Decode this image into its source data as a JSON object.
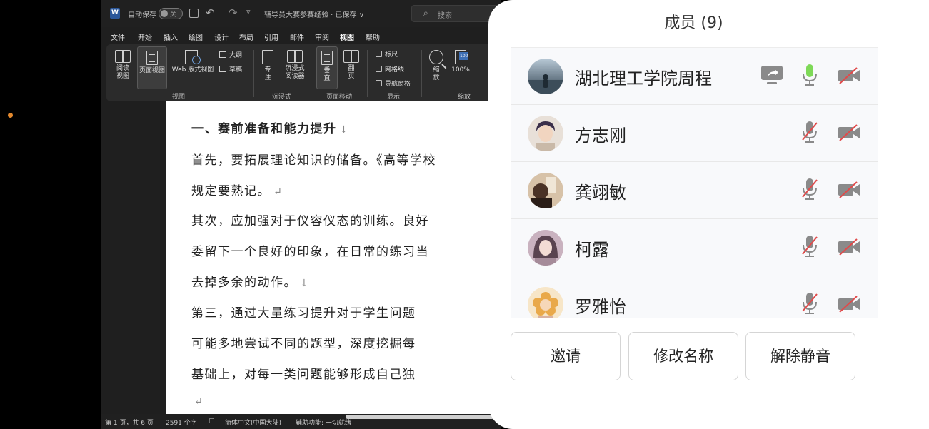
{
  "word": {
    "titlebar": {
      "logo_letter": "W",
      "autosave_label": "自动保存",
      "autosave_state": "关",
      "doc_title": "辅导员大赛参赛经验 · 已保存 ∨",
      "search_placeholder": "搜索"
    },
    "menu": [
      "文件",
      "开始",
      "插入",
      "绘图",
      "设计",
      "布局",
      "引用",
      "邮件",
      "审阅",
      "视图",
      "帮助"
    ],
    "active_menu": "视图",
    "ribbon": {
      "view_group": {
        "label": "视图",
        "read": "阅读\n视图",
        "page": "页面视图",
        "web": "Web 版式视图",
        "outline": "大纲",
        "draft": "草稿"
      },
      "immersive_group": {
        "label": "沉浸式",
        "focus": "专\n注",
        "reader": "沉浸式\n阅读器"
      },
      "page_move_group": {
        "label": "页面移动",
        "vertical": "垂\n直",
        "flip": "翻\n页"
      },
      "show_group": {
        "label": "显示",
        "ruler": "标尺",
        "grid": "网格线",
        "nav": "导航窗格"
      },
      "zoom_group": {
        "label": "缩放",
        "zoom": "缩\n放",
        "pct": "100%"
      }
    },
    "document": {
      "lines": [
        {
          "text": "一、赛前准备和能力提升",
          "mark": "↓",
          "heading": true
        },
        {
          "text": "首先，要拓展理论知识的储备。《高等学校",
          "mark": "",
          "heading": false
        },
        {
          "text": "规定要熟记。",
          "mark": "↵",
          "heading": false
        },
        {
          "text": "其次，应加强对于仪容仪态的训练。良好",
          "mark": "",
          "heading": false
        },
        {
          "text": "委留下一个良好的印象，在日常的练习当",
          "mark": "",
          "heading": false
        },
        {
          "text": "去掉多余的动作。",
          "mark": "↓",
          "heading": false
        },
        {
          "text": "第三，通过大量练习提升对于学生问题",
          "mark": "",
          "heading": false
        },
        {
          "text": "可能多地尝试不同的题型，深度挖掘每",
          "mark": "",
          "heading": false
        },
        {
          "text": "基础上，对每一类问题能够形成自己独",
          "mark": "",
          "heading": false
        },
        {
          "text": "",
          "mark": "↵",
          "heading": false
        }
      ]
    },
    "status": {
      "page": "第 1 页，共 6 页",
      "words": "2591 个字",
      "lang": "简体中文(中国大陆)",
      "access": "辅助功能: 一切就绪"
    }
  },
  "panel": {
    "title": "成员 (9)",
    "members": [
      {
        "name": "湖北理工学院周程",
        "sharing": true,
        "mic_on": true,
        "cam_on": false,
        "avatar_color": "#4a6172"
      },
      {
        "name": "方志刚",
        "sharing": false,
        "mic_on": false,
        "cam_on": false,
        "avatar_color": "#c9b9a8"
      },
      {
        "name": "龚翊敏",
        "sharing": false,
        "mic_on": false,
        "cam_on": false,
        "avatar_color": "#6b4f3d"
      },
      {
        "name": "柯露",
        "sharing": false,
        "mic_on": false,
        "cam_on": false,
        "avatar_color": "#a58b99"
      },
      {
        "name": "罗雅怡",
        "sharing": false,
        "mic_on": false,
        "cam_on": false,
        "avatar_color": "#e9c48a"
      }
    ],
    "buttons": {
      "invite": "邀请",
      "rename": "修改名称",
      "unmute": "解除静音"
    },
    "colors": {
      "mic_active": "#7ed957",
      "muted_slash": "#e04a4a",
      "icon_gray": "#8a8a8a"
    }
  }
}
